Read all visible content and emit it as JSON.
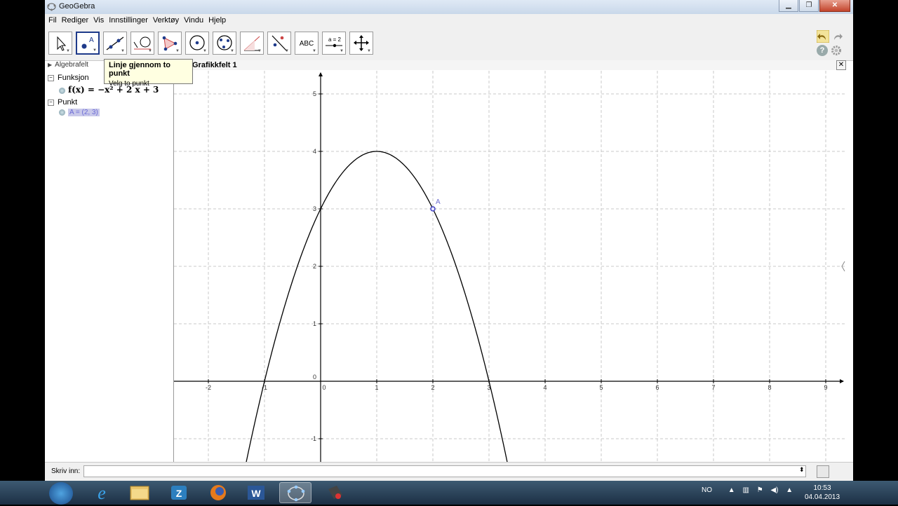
{
  "window": {
    "title": "GeoGebra"
  },
  "menu": [
    "Fil",
    "Rediger",
    "Vis",
    "Innstillinger",
    "Verktøy",
    "Vindu",
    "Hjelp"
  ],
  "toolbar": {
    "tools": [
      {
        "name": "move-tool"
      },
      {
        "name": "point-tool"
      },
      {
        "name": "line-tool"
      },
      {
        "name": "perpendicular-tool"
      },
      {
        "name": "polygon-tool"
      },
      {
        "name": "circle-tool"
      },
      {
        "name": "ellipse-tool"
      },
      {
        "name": "angle-tool"
      },
      {
        "name": "reflect-tool"
      },
      {
        "name": "text-tool",
        "label": "ABC"
      },
      {
        "name": "slider-tool",
        "label": "a = 2"
      },
      {
        "name": "move-view-tool"
      }
    ]
  },
  "tooltip": {
    "title": "Linje gjennom to punkt",
    "hint": "Velg to punkt"
  },
  "algebra": {
    "header": "Algebrafelt",
    "groups": [
      {
        "label": "Funksjon",
        "item": "f(x) = −x² + 2 x + 3"
      },
      {
        "label": "Punkt",
        "item": "A = (2, 3)"
      }
    ]
  },
  "graphics": {
    "header": "Grafikkfelt 1",
    "xticks": [
      "-2",
      "-1",
      "0",
      "1",
      "2",
      "3",
      "4",
      "5",
      "6",
      "7",
      "8",
      "9"
    ],
    "yticks": [
      "5",
      "4",
      "3",
      "2",
      "1",
      "0",
      "-1"
    ],
    "point_label": "A"
  },
  "inputbar": {
    "label": "Skriv inn:"
  },
  "taskbar": {
    "lang": "NO",
    "time": "10:53",
    "date": "04.04.2013"
  },
  "colors": {
    "selected_tool": "#1e3a8a",
    "point": "#4040c0",
    "grid": "#c8c8c8"
  }
}
